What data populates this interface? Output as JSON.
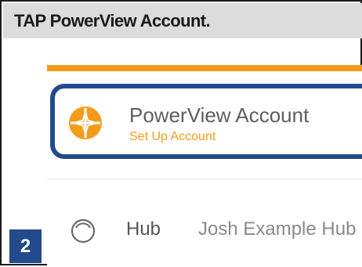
{
  "instruction": {
    "text": "TAP PowerView Account."
  },
  "step": {
    "number": "2"
  },
  "account_row": {
    "title": "PowerView Account",
    "subtitle": "Set Up Account",
    "icon": "powerview-logo-icon"
  },
  "hub_row": {
    "label": "Hub",
    "value": "Josh Example Hub",
    "icon": "hub-ring-icon"
  },
  "colors": {
    "accent_orange": "#f39c1b",
    "highlight_blue": "#234a8c",
    "header_gray": "#dcdcdc"
  }
}
